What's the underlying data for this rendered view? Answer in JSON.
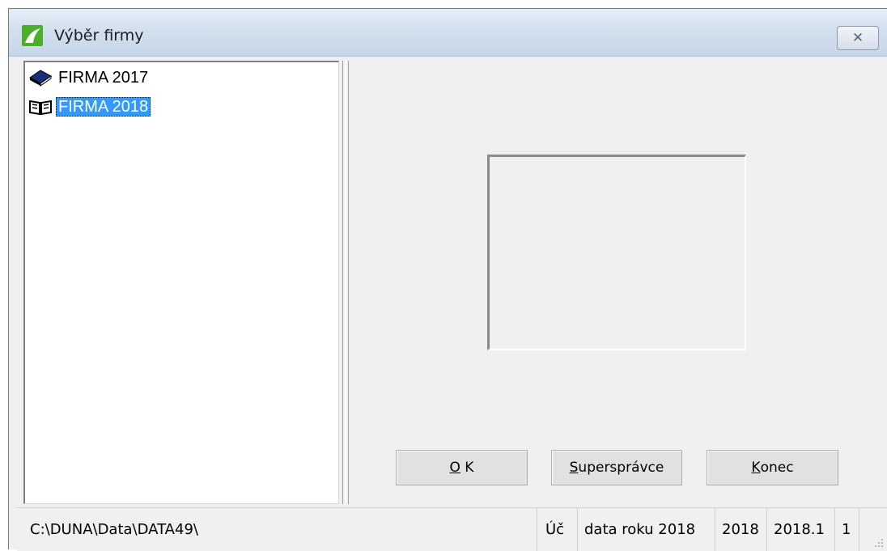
{
  "window": {
    "title": "Výběr firmy",
    "close_symbol": "✕"
  },
  "icons": {
    "app": "app-logo-icon",
    "closed_book": "closed-book-icon",
    "open_book": "open-book-icon",
    "close": "close-icon",
    "grip": "resize-grip-icon"
  },
  "tree": {
    "items": [
      {
        "label": "FIRMA 2017",
        "icon": "closed-book-icon",
        "selected": false
      },
      {
        "label": "FIRMA 2018",
        "icon": "open-book-icon",
        "selected": true
      }
    ]
  },
  "buttons": {
    "ok": {
      "mnemonic": "O",
      "rest": " K"
    },
    "superspravce": {
      "mnemonic": "S",
      "rest": "upersprávce"
    },
    "konec": {
      "mnemonic": "K",
      "rest": "onec"
    }
  },
  "status": {
    "path": "C:\\DUNA\\Data\\DATA49\\",
    "type": "Úč",
    "description": "data roku 2018",
    "year": "2018",
    "version": "2018.1",
    "number": "1"
  },
  "colors": {
    "selection": "#3399ff",
    "app_icon_green": "#4caf2a"
  }
}
